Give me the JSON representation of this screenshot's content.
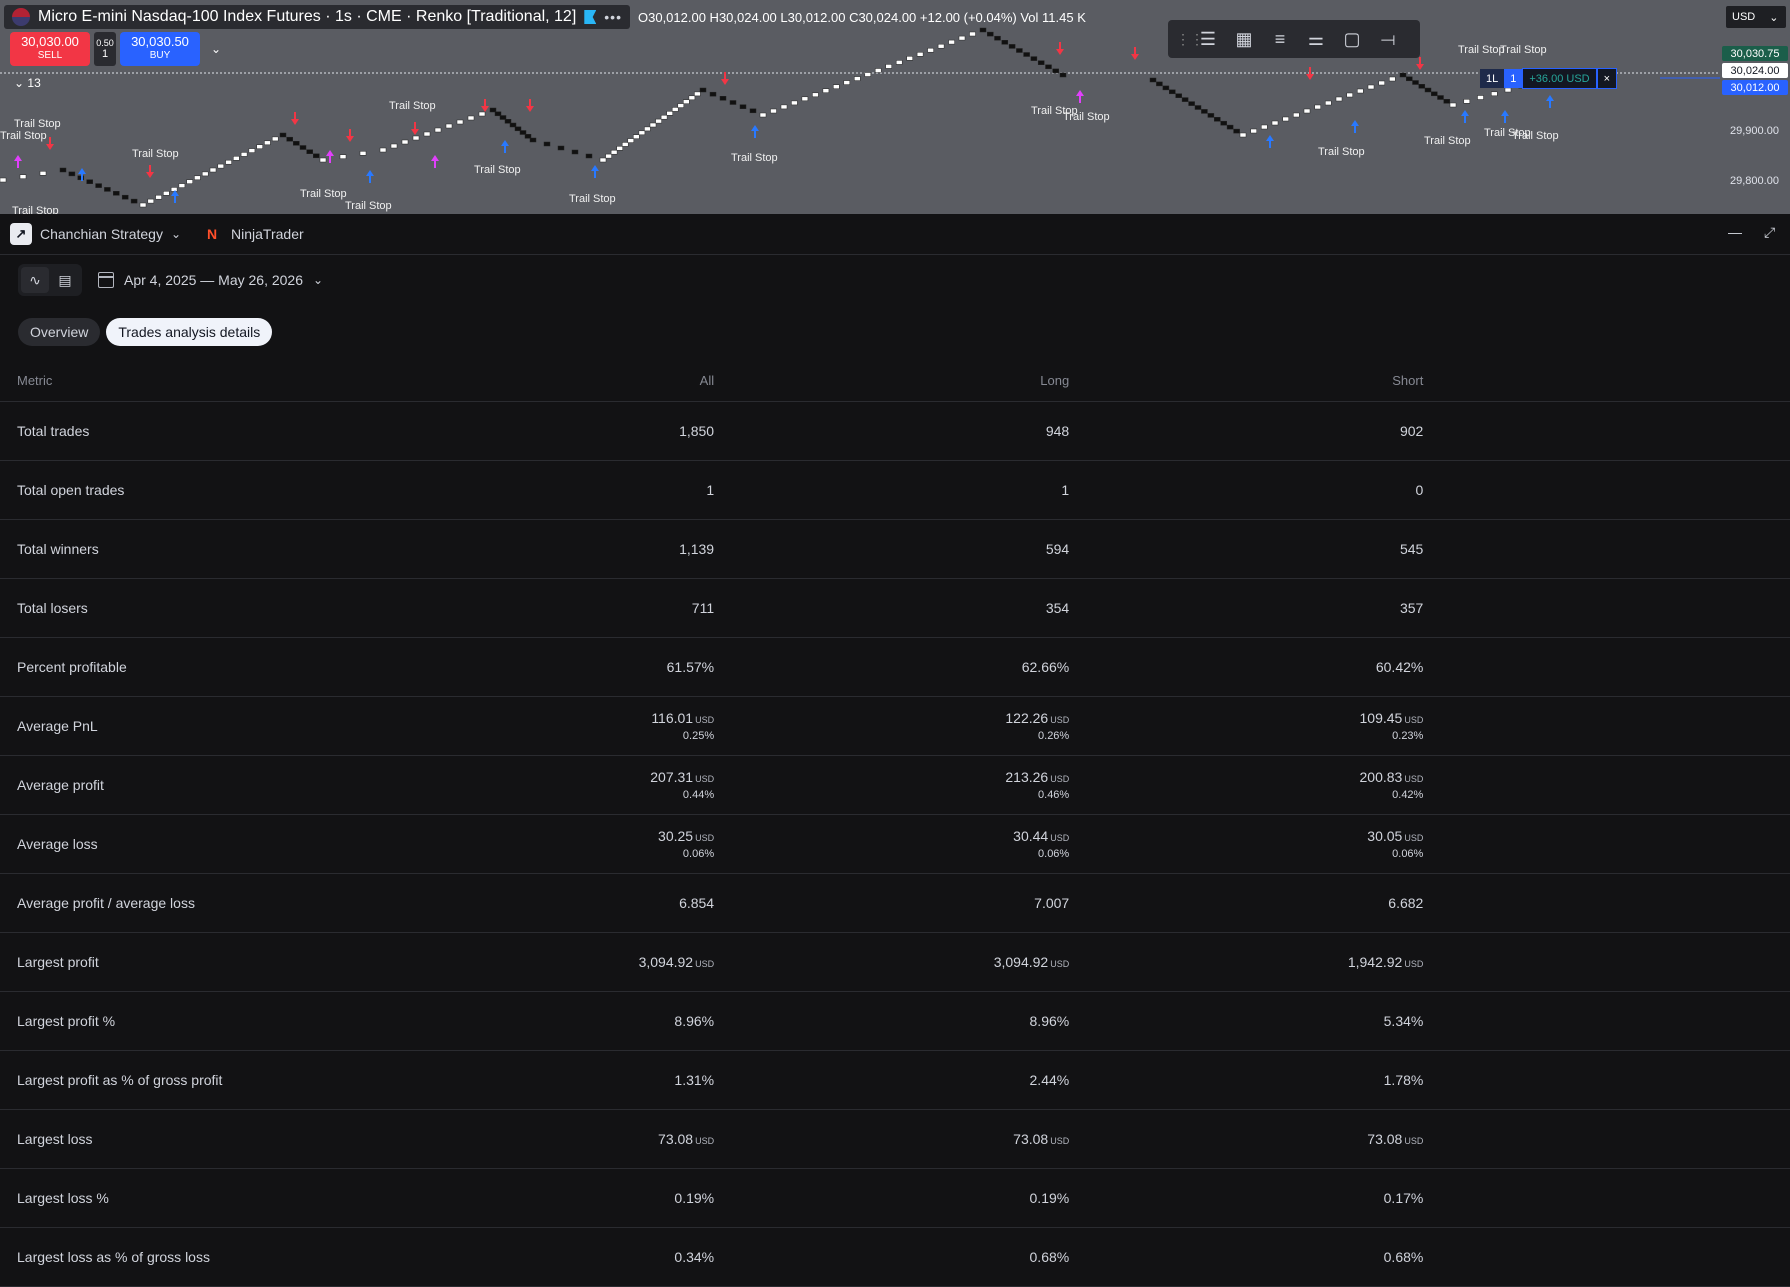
{
  "chart": {
    "title": "Micro E-mini Nasdaq-100 Index Futures · 1s · CME · Renko [Traditional, 12]",
    "ohlc": "O30,012.00 H30,024.00 L30,012.00 C30,024.00 +12.00 (+0.04%) Vol 11.45 K",
    "sell_price": "30,030.00",
    "sell_label": "SELL",
    "buy_price": "30,030.50",
    "buy_label": "BUY",
    "spread": "0.50",
    "qty": "1",
    "indicators_count": "13",
    "currency": "USD",
    "price_labels": [
      "29,900.00",
      "29,800.00"
    ],
    "price_tag_ask": "30,030.75",
    "price_tag_last": "30,024.00",
    "price_tag_bid": "30,012.00",
    "position_qty": "1",
    "position_pnl": "+36.00 USD",
    "position_close": "×",
    "position_icon": "1L",
    "chart_labels": [
      {
        "text": "Trail Stop"
      },
      {
        "text": "Trail Stop"
      },
      {
        "text": "Trail Stop"
      },
      {
        "text": "Trail Stop"
      },
      {
        "text": "Trail Stop"
      },
      {
        "text": "Trail Stop"
      },
      {
        "text": "Trail Stop"
      },
      {
        "text": "Trail Stop"
      },
      {
        "text": "Trail Stop"
      },
      {
        "text": "Trail Stop"
      },
      {
        "text": "Trail Stop"
      },
      {
        "text": "Trail Stop"
      },
      {
        "text": "Trail Stop"
      },
      {
        "text": "Trail Stop"
      },
      {
        "text": "Trail Stop"
      },
      {
        "text": "Trail Stop"
      },
      {
        "text": "Trail Stop"
      },
      {
        "text": "Trail Stop"
      }
    ]
  },
  "panel": {
    "tabs": [
      {
        "label": "Chanchian Strategy",
        "icon": "strategy-icon"
      },
      {
        "label": "NinjaTrader",
        "icon": "ninjatrader-icon"
      }
    ],
    "date_range": "Apr 4, 2025 — May 26, 2026",
    "sub_tabs": [
      "Overview",
      "Trades analysis details"
    ],
    "columns": [
      "Metric",
      "All",
      "Long",
      "Short"
    ],
    "rows": [
      {
        "metric": "Total trades",
        "all": "1,850",
        "long": "948",
        "short": "902"
      },
      {
        "metric": "Total open trades",
        "all": "1",
        "long": "1",
        "short": "0"
      },
      {
        "metric": "Total winners",
        "all": "1,139",
        "long": "594",
        "short": "545"
      },
      {
        "metric": "Total losers",
        "all": "711",
        "long": "354",
        "short": "357"
      },
      {
        "metric": "Percent profitable",
        "all": "61.57%",
        "long": "62.66%",
        "short": "60.42%"
      },
      {
        "metric": "Average PnL",
        "all": "116.01",
        "all_cur": "USD",
        "all_pct": "0.25%",
        "long": "122.26",
        "long_cur": "USD",
        "long_pct": "0.26%",
        "short": "109.45",
        "short_cur": "USD",
        "short_pct": "0.23%"
      },
      {
        "metric": "Average profit",
        "all": "207.31",
        "all_cur": "USD",
        "all_pct": "0.44%",
        "long": "213.26",
        "long_cur": "USD",
        "long_pct": "0.46%",
        "short": "200.83",
        "short_cur": "USD",
        "short_pct": "0.42%"
      },
      {
        "metric": "Average loss",
        "all": "30.25",
        "all_cur": "USD",
        "all_pct": "0.06%",
        "long": "30.44",
        "long_cur": "USD",
        "long_pct": "0.06%",
        "short": "30.05",
        "short_cur": "USD",
        "short_pct": "0.06%"
      },
      {
        "metric": "Average profit / average loss",
        "all": "6.854",
        "long": "7.007",
        "short": "6.682"
      },
      {
        "metric": "Largest profit",
        "all": "3,094.92",
        "all_cur": "USD",
        "long": "3,094.92",
        "long_cur": "USD",
        "short": "1,942.92",
        "short_cur": "USD"
      },
      {
        "metric": "Largest profit %",
        "all": "8.96%",
        "long": "8.96%",
        "short": "5.34%"
      },
      {
        "metric": "Largest profit as % of gross profit",
        "all": "1.31%",
        "long": "2.44%",
        "short": "1.78%"
      },
      {
        "metric": "Largest loss",
        "all": "73.08",
        "all_cur": "USD",
        "long": "73.08",
        "long_cur": "USD",
        "short": "73.08",
        "short_cur": "USD"
      },
      {
        "metric": "Largest loss %",
        "all": "0.19%",
        "long": "0.19%",
        "short": "0.17%"
      },
      {
        "metric": "Largest loss as % of gross loss",
        "all": "0.34%",
        "long": "0.68%",
        "short": "0.68%"
      }
    ]
  },
  "colors": {
    "sell": "#f23645",
    "buy": "#2962ff",
    "chart_bg": "#5a5c62",
    "panel_bg": "#121214"
  }
}
